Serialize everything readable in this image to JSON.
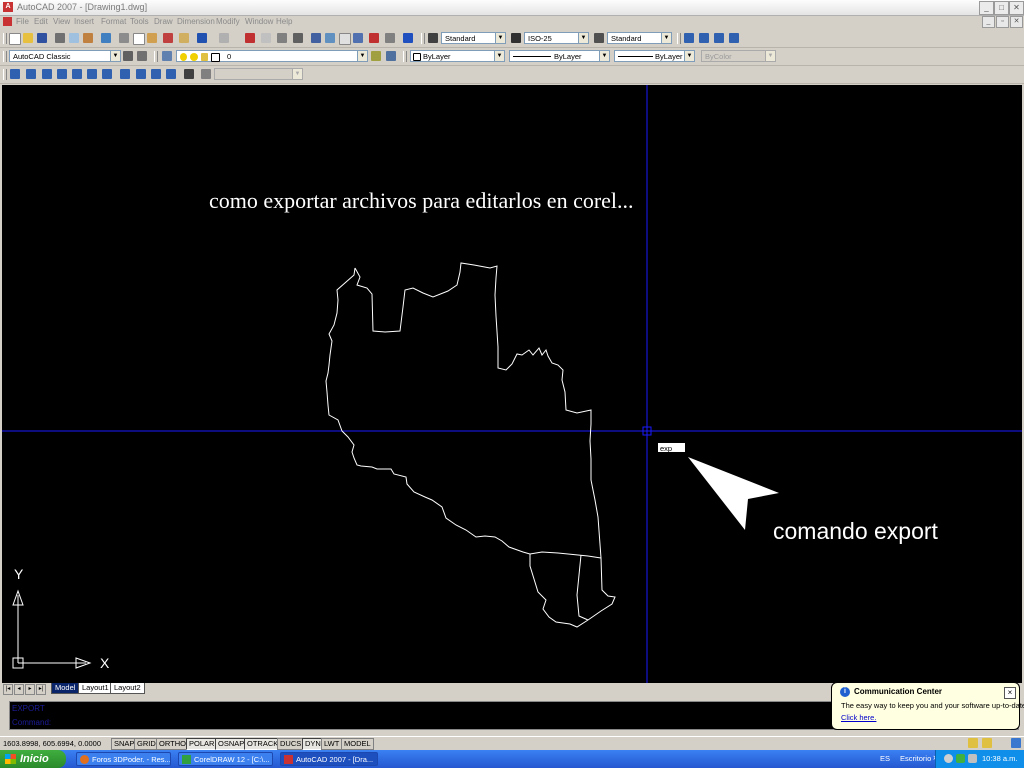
{
  "window": {
    "app_icon_letter": "A",
    "title": "AutoCAD 2007 - [Drawing1.dwg]",
    "minimize": "_",
    "maximize": "□",
    "close": "✕",
    "doc_minimize": "_",
    "doc_restore": "▫",
    "doc_close": "✕"
  },
  "menu": [
    "File",
    "Edit",
    "View",
    "Insert",
    "Format",
    "Tools",
    "Draw",
    "Dimension",
    "Modify",
    "Window",
    "Help"
  ],
  "styles_toolbar": {
    "text_style": "Standard",
    "dim_style": "ISO-25",
    "table_style": "Standard"
  },
  "workspace": "AutoCAD Classic",
  "layer": "0",
  "properties": {
    "color": "ByLayer",
    "linetype": "ByLayer",
    "lineweight": "ByLayer",
    "plot_style": "ByColor"
  },
  "canvas": {
    "annotation": "como exportar archivos para editarlos en corel...",
    "callout": "comando export",
    "command_tooltip": "exp",
    "ucs_y": "Y",
    "ucs_x": "X"
  },
  "layout_tabs": {
    "nav": [
      "|◂",
      "◂",
      "▸",
      "▸|"
    ],
    "tabs": [
      "Model",
      "Layout1",
      "Layout2"
    ]
  },
  "command_window": {
    "line1": "EXPORT",
    "line2": "Command:"
  },
  "status_bar": {
    "coordinates": "1603.8998, 605.6994, 0.0000",
    "toggles": [
      "SNAP",
      "GRID",
      "ORTHO",
      "POLAR",
      "OSNAP",
      "OTRACK",
      "DUCS",
      "DYN",
      "LWT",
      "MODEL"
    ]
  },
  "balloon": {
    "title": "Communication Center",
    "text": "The easy way to keep you and your software up-to-date.",
    "link": "Click here."
  },
  "taskbar": {
    "start_label": "Inicio",
    "tasks": [
      "Foros 3DPoder. - Res...",
      "CorelDRAW 12 - [C:\\...",
      "AutoCAD 2007 - [Dra..."
    ],
    "language": "ES",
    "desktop_label": "Escritorio",
    "chevron": "»",
    "clock": "10:38 a.m."
  }
}
